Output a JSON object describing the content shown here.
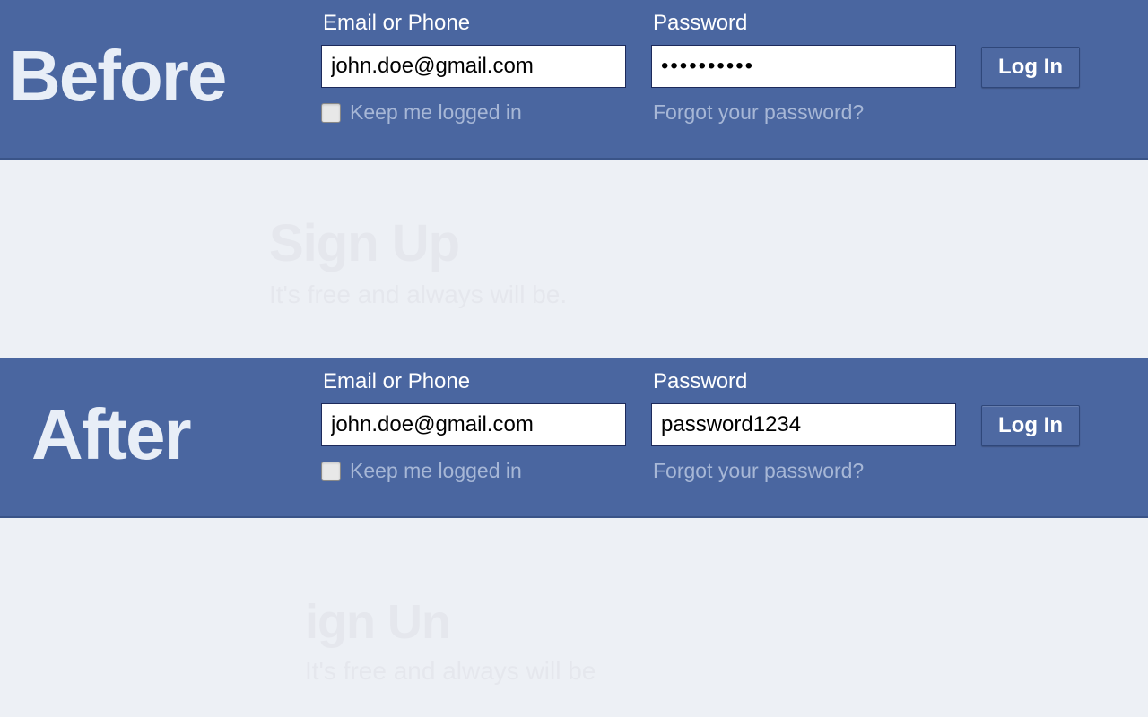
{
  "before": {
    "overlayLabel": "Before",
    "emailLabel": "Email or Phone",
    "emailValue": "john.doe@gmail.com",
    "passwordLabel": "Password",
    "passwordValue": "••••••••••",
    "keepLoggedIn": "Keep me logged in",
    "forgot": "Forgot your password?",
    "loginBtn": "Log In",
    "signupTitle": "Sign Up",
    "signupSub": "It's free and always will be."
  },
  "after": {
    "overlayLabel": "After",
    "emailLabel": "Email or Phone",
    "emailValue": "john.doe@gmail.com",
    "passwordLabel": "Password",
    "passwordValue": "password1234",
    "keepLoggedIn": "Keep me logged in",
    "forgot": "Forgot your password?",
    "loginBtn": "Log In",
    "signupTitle": "ign Un",
    "signupSub": "It's free and always will be"
  }
}
